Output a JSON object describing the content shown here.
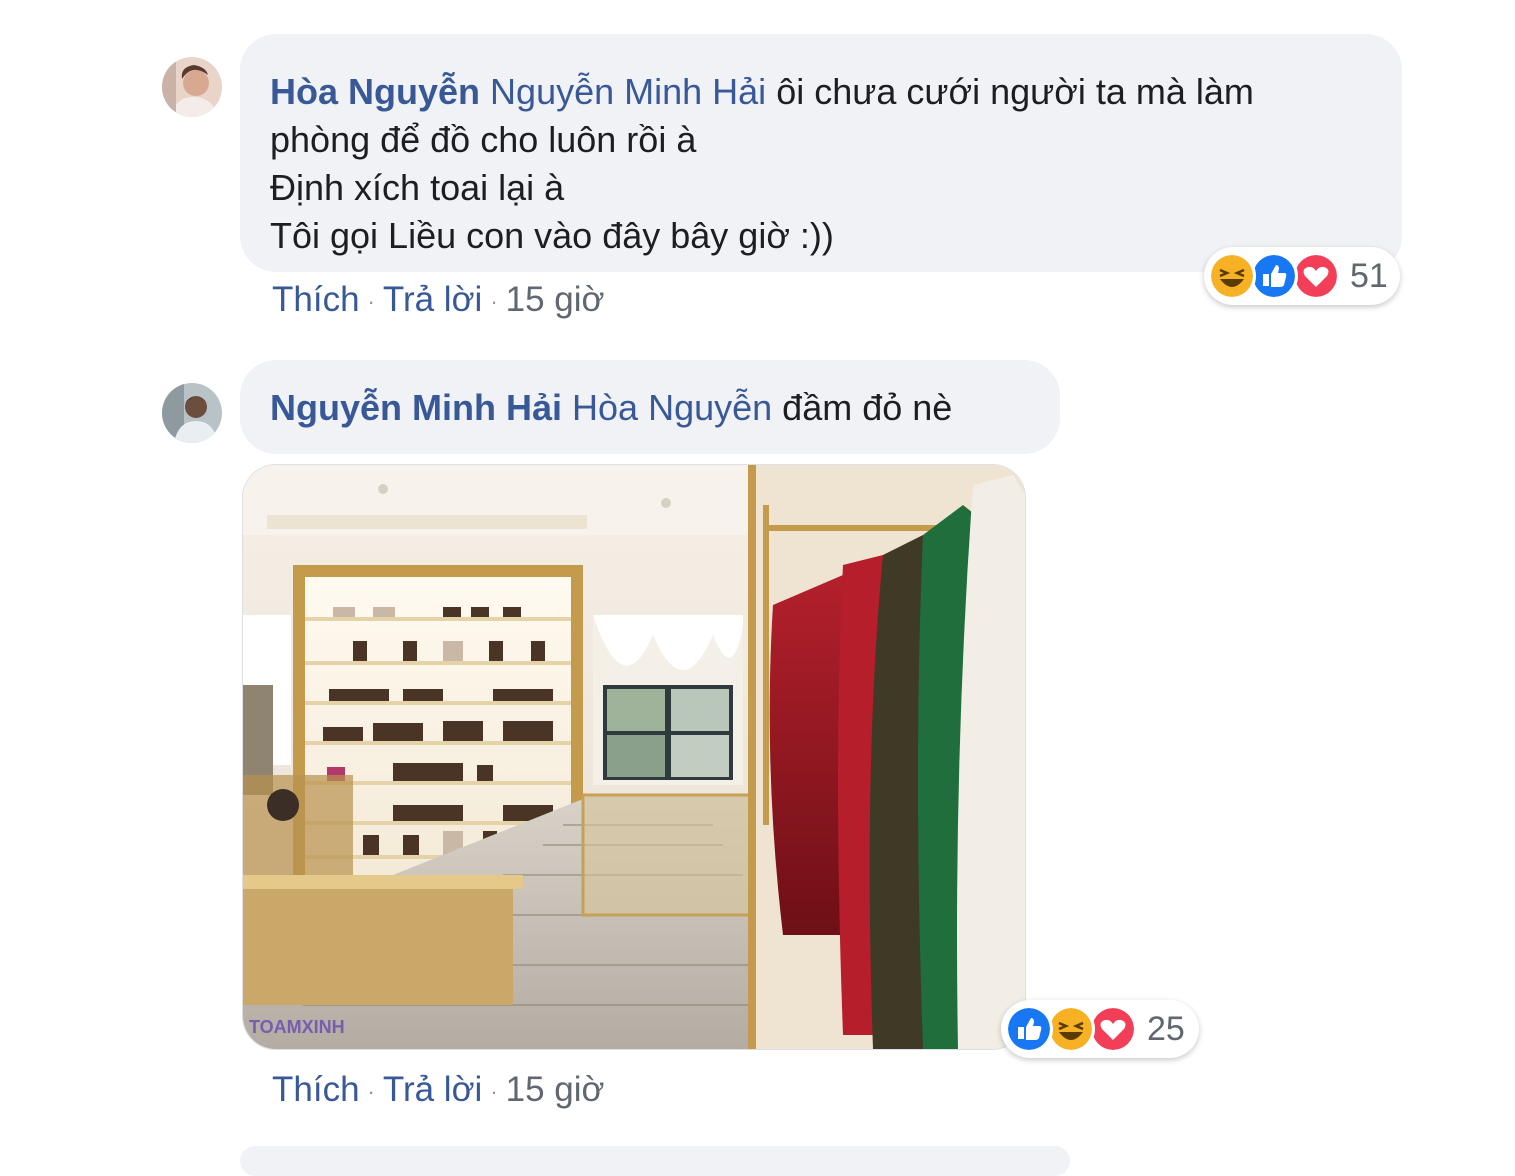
{
  "comments": [
    {
      "author": "Hòa Nguyễn",
      "mention": "Nguyễn Minh Hải",
      "text_first": " ôi chưa cưới người ta mà làm",
      "lines": [
        "phòng để đồ cho luôn rồi à",
        "Định xích toai lại à",
        "Tôi gọi Liều con vào đây bây giờ :))"
      ],
      "actions": {
        "like": "Thích",
        "reply": "Trả lời",
        "time": "15 giờ"
      },
      "reactions": {
        "icons": [
          "haha-icon",
          "like-icon",
          "love-icon"
        ],
        "count": "51"
      }
    },
    {
      "author": "Nguyễn Minh Hải",
      "mention": "Hòa Nguyễn",
      "text_first": " đầm đỏ nè",
      "image": {
        "description": "closet-room-photo",
        "watermark": "TOAMXINH"
      },
      "actions": {
        "like": "Thích",
        "reply": "Trả lời",
        "time": "15 giờ"
      },
      "reactions": {
        "icons": [
          "like-icon",
          "haha-icon",
          "love-icon"
        ],
        "count": "25"
      }
    }
  ],
  "separator": "·",
  "colors": {
    "link": "#385898",
    "bubble": "#f0f2f5",
    "muted": "#606770",
    "like": "#1877f2",
    "love": "#f33e58",
    "haha": "#f7b125"
  }
}
